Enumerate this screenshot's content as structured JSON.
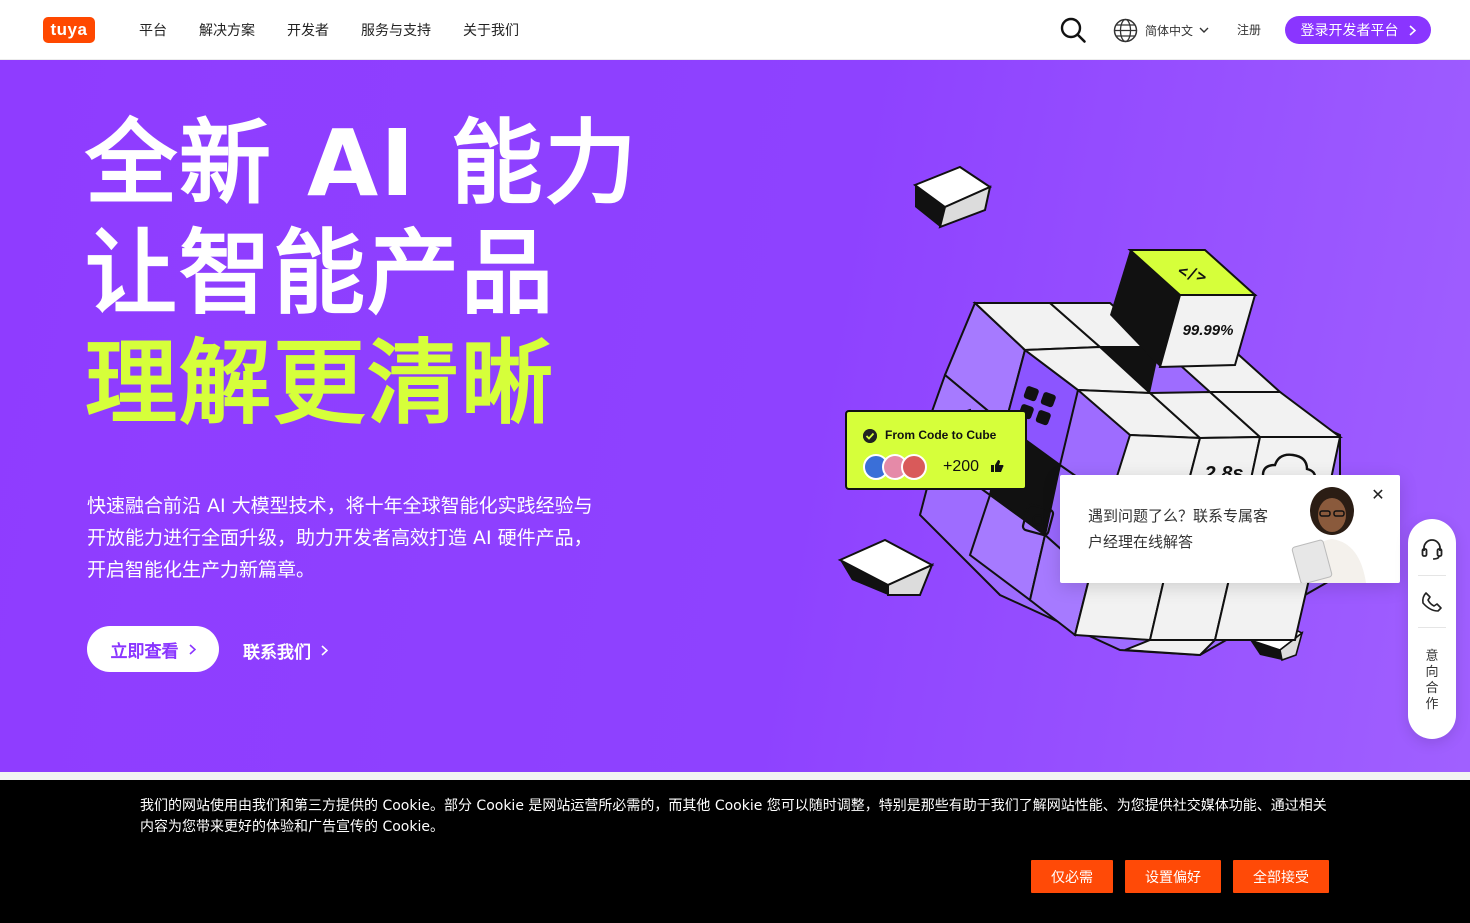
{
  "header": {
    "logo_text": "tuya",
    "nav": [
      "平台",
      "解决方案",
      "开发者",
      "服务与支持",
      "关于我们"
    ],
    "language": "简体中文",
    "register": "注册",
    "login": "登录开发者平台"
  },
  "hero": {
    "title_line1": "全新 AI 能力",
    "title_line2": "让智能产品",
    "title_line3": "理解更清晰",
    "description": "快速融合前沿 AI 大模型技术，将十年全球智能化实践经验与开放能力进行全面升级，助力开发者高效打造 AI 硬件产品，开启智能化生产力新篇章。",
    "cta_primary": "立即查看",
    "cta_secondary": "联系我们",
    "accent_color": "#d6ff3a"
  },
  "cube": {
    "code_icon_text": "</>",
    "uptime": "99.99%",
    "latency": "2.8s",
    "card_title": "From Code to Cube",
    "card_count": "+200"
  },
  "chat": {
    "message": "遇到问题了么？联系专属客户经理在线解答"
  },
  "side_rail": {
    "intent_label": "意向合作"
  },
  "cookie": {
    "text": "我们的网站使用由我们和第三方提供的 Cookie。部分 Cookie 是网站运营所必需的，而其他 Cookie 您可以随时调整，特别是那些有助于我们了解网站性能、为您提供社交媒体功能、通过相关内容为您带来更好的体验和广告宣传的 Cookie。",
    "btn_necessary": "仅必需",
    "btn_preferences": "设置偏好",
    "btn_accept_all": "全部接受"
  }
}
